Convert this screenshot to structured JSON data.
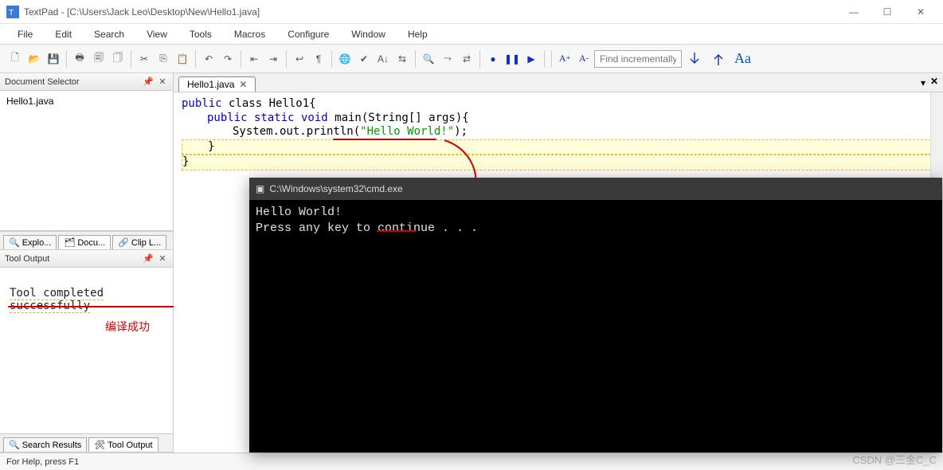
{
  "window": {
    "title": "TextPad - [C:\\Users\\Jack Leo\\Desktop\\New\\Hello1.java]",
    "btn_min": "—",
    "btn_max": "☐",
    "btn_close": "✕"
  },
  "menu": [
    "File",
    "Edit",
    "Search",
    "View",
    "Tools",
    "Macros",
    "Configure",
    "Window",
    "Help"
  ],
  "find_placeholder": "Find incrementally",
  "doc_selector": {
    "title": "Document Selector",
    "items": [
      "Hello1.java"
    ]
  },
  "left_tabs": [
    "Explo...",
    "Docu...",
    "Clip L..."
  ],
  "tool_output": {
    "title": "Tool Output",
    "text": "Tool completed successfully",
    "annotation": "编译成功"
  },
  "bottom_tabs2": [
    "Search Results",
    "Tool Output"
  ],
  "editor": {
    "tab_label": "Hello1.java",
    "code": {
      "l1a": "public",
      "l1b": " class ",
      "l1c": "Hello1{",
      "l2a": "public static void",
      "l2b": " main(String[] args){",
      "l3a": "System.out.println(",
      "l3b": "\"Hello World!\"",
      "l3c": ");",
      "l4": "}",
      "l5": "}"
    }
  },
  "cmd": {
    "title": "C:\\Windows\\system32\\cmd.exe",
    "line1": "Hello World!",
    "line2": "Press any key to continue . . ."
  },
  "status": "For Help, press F1",
  "watermark": "CSDN @三金C_C"
}
